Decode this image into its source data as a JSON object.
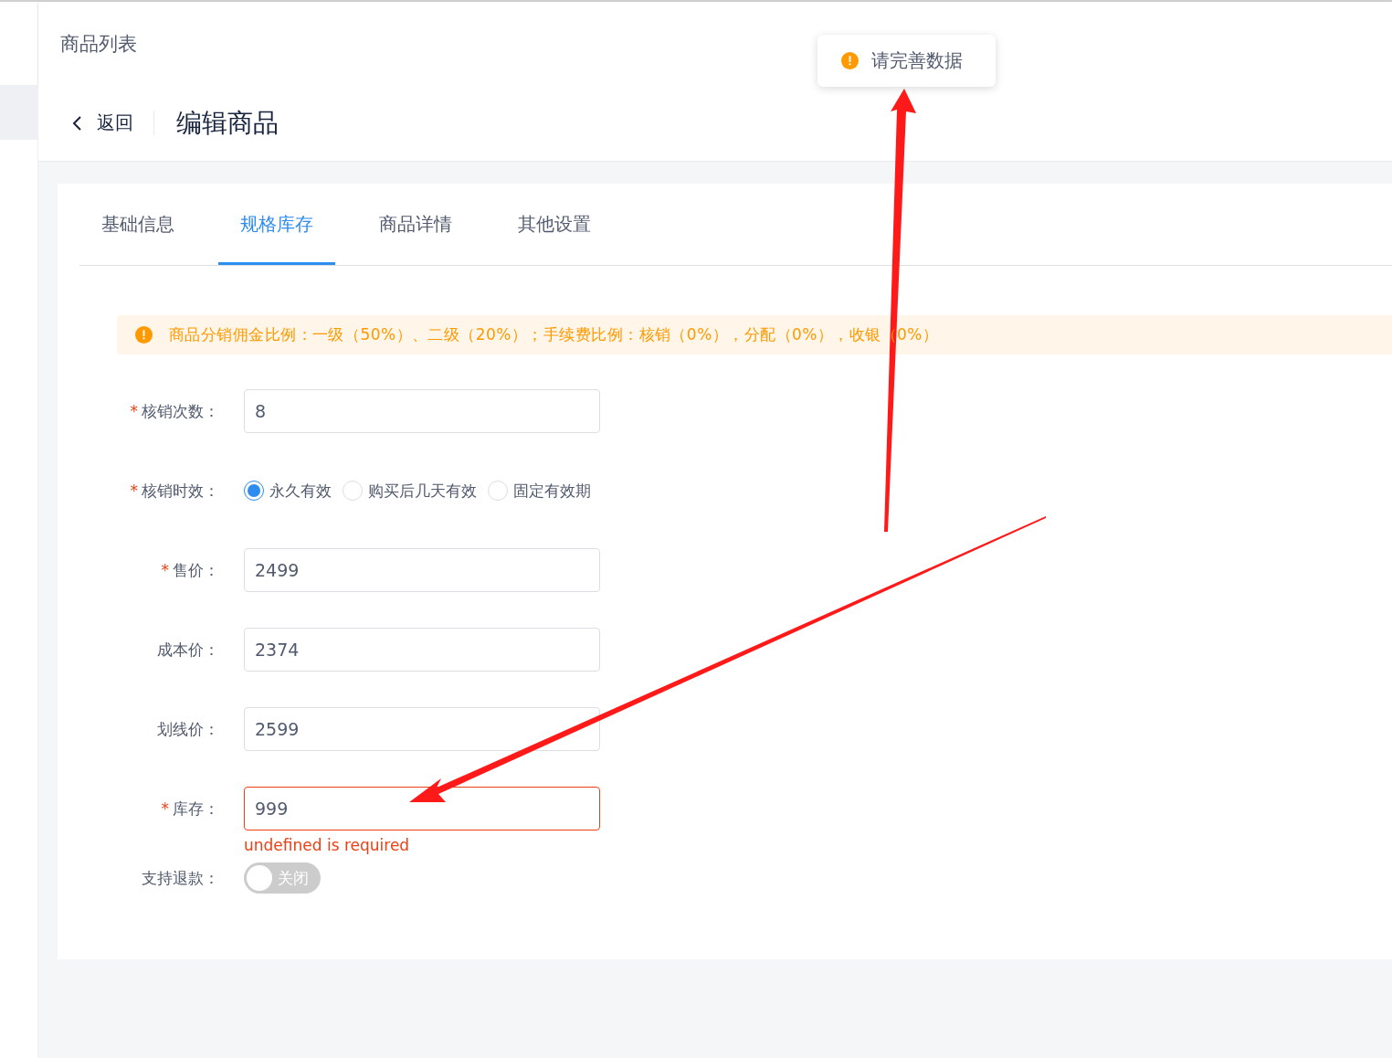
{
  "top_bar": {
    "title": "商品列表"
  },
  "toast": {
    "text": "请完善数据"
  },
  "page_header": {
    "back": "返回",
    "title": "编辑商品"
  },
  "tabs": [
    {
      "label": "基础信息",
      "selected": false
    },
    {
      "label": "规格库存",
      "selected": true
    },
    {
      "label": "商品详情",
      "selected": false
    },
    {
      "label": "其他设置",
      "selected": false
    }
  ],
  "notice": {
    "text": "商品分销佣金比例：一级（50%）、二级（20%）；手续费比例：核销（0%），分配（0%），收银（0%）"
  },
  "form": [
    {
      "kind": "input",
      "label": "核销次数：",
      "marker": "*",
      "value": "8"
    },
    {
      "kind": "radio",
      "label": "核销时效：",
      "marker": "*",
      "options": [
        {
          "label": "永久有效",
          "selected": true
        },
        {
          "label": "购买后几天有效",
          "selected": false
        },
        {
          "label": "固定有效期",
          "selected": false
        }
      ]
    },
    {
      "kind": "input",
      "label": "售价：",
      "marker": "*",
      "value": "2499"
    },
    {
      "kind": "input",
      "label": "成本价：",
      "value": "2374"
    },
    {
      "kind": "input",
      "label": "划线价：",
      "value": "2599"
    },
    {
      "kind": "input",
      "label": "库存：",
      "marker": "*",
      "value": "999",
      "error": "undefined is required"
    },
    {
      "kind": "switch",
      "label": "支持退款：",
      "on": false,
      "text": "关闭"
    }
  ]
}
